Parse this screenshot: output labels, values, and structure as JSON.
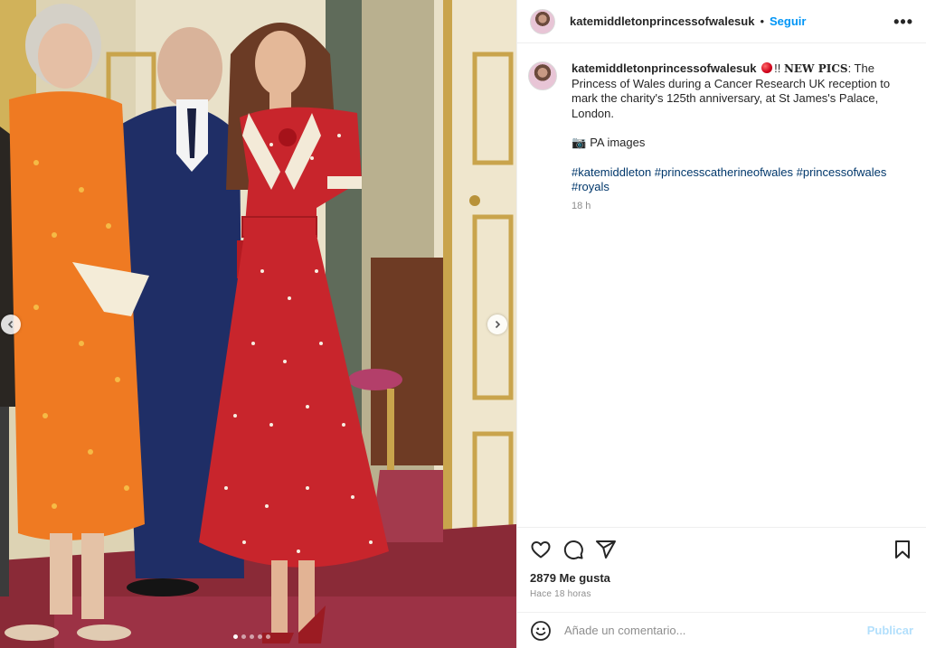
{
  "post": {
    "username": "katemiddletonprincessofwalesuk",
    "follow_label": "Seguir",
    "separator": "•",
    "more_label": "•••",
    "caption_emoji": "red-circle",
    "caption_exclaim": "!!",
    "caption_bold": "NEW PICS",
    "caption_text": ": The Princess of Wales during a Cancer Research UK reception to mark the charity's 125th anniversary, at St James's Palace, London.",
    "credit_icon": "camera-emoji",
    "credit_glyph": "📷",
    "credit_text": "PA images",
    "hashtags": [
      "#katemiddleton",
      "#princesscatherineofwales",
      "#princessofwales",
      "#royals"
    ],
    "caption_time": "18 h",
    "likes": "2879 Me gusta",
    "posted_ago": "Hace 18 horas"
  },
  "comment": {
    "placeholder": "Añade un comentario...",
    "publish_label": "Publicar"
  },
  "carousel": {
    "slide_count": 5,
    "active_index": 0
  },
  "icons": [
    "heart-icon",
    "comment-icon",
    "share-icon",
    "bookmark-icon",
    "emoji-icon",
    "chevron-left-icon",
    "chevron-right-icon",
    "more-options-icon"
  ],
  "colors": {
    "accent": "#0095f6",
    "hashtag": "#00376b",
    "publish_disabled": "#b2dffc",
    "muted": "#8e8e8e"
  }
}
